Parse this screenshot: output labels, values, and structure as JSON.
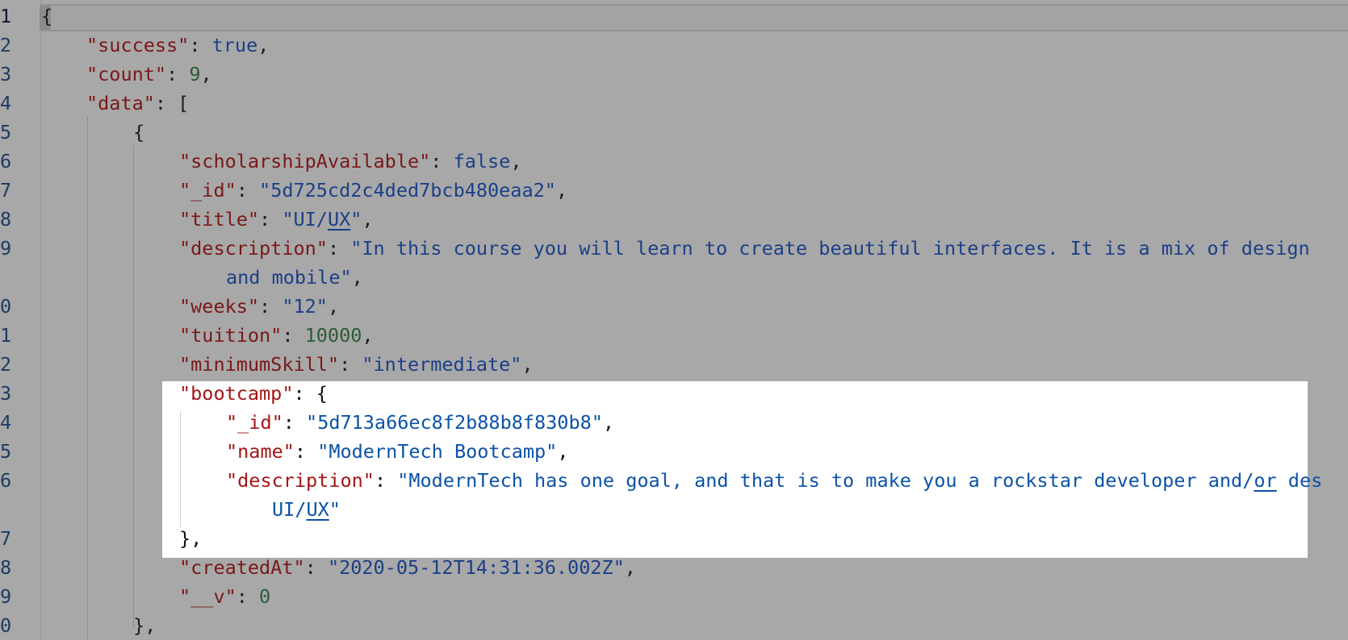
{
  "gutter": [
    "1",
    "2",
    "3",
    "4",
    "5",
    "6",
    "7",
    "8",
    "9",
    "0",
    "1",
    "2",
    "3",
    "4",
    "5",
    "6",
    "7",
    "8",
    "9",
    "0"
  ],
  "lines": [
    {
      "num_index": 0,
      "tokens": [
        {
          "t": "p",
          "v": "{"
        }
      ]
    },
    {
      "num_index": 1,
      "tokens": [
        {
          "t": "key",
          "v": "\"success\""
        },
        {
          "t": "p",
          "v": ": "
        },
        {
          "t": "bool",
          "v": "true"
        },
        {
          "t": "p",
          "v": ","
        }
      ]
    },
    {
      "num_index": 2,
      "tokens": [
        {
          "t": "key",
          "v": "\"count\""
        },
        {
          "t": "p",
          "v": ": "
        },
        {
          "t": "num",
          "v": "9"
        },
        {
          "t": "p",
          "v": ","
        }
      ]
    },
    {
      "num_index": 3,
      "tokens": [
        {
          "t": "key",
          "v": "\"data\""
        },
        {
          "t": "p",
          "v": ": ["
        }
      ]
    },
    {
      "num_index": 4,
      "tokens": [
        {
          "t": "p",
          "v": "{"
        }
      ]
    },
    {
      "num_index": 5,
      "tokens": [
        {
          "t": "key",
          "v": "\"scholarshipAvailable\""
        },
        {
          "t": "p",
          "v": ": "
        },
        {
          "t": "bool",
          "v": "false"
        },
        {
          "t": "p",
          "v": ","
        }
      ]
    },
    {
      "num_index": 6,
      "tokens": [
        {
          "t": "key",
          "v": "\"_id\""
        },
        {
          "t": "p",
          "v": ": "
        },
        {
          "t": "str",
          "v": "\"5d725cd2c4ded7bcb480eaa2\""
        },
        {
          "t": "p",
          "v": ","
        }
      ]
    },
    {
      "num_index": 7,
      "tokens": [
        {
          "t": "key",
          "v": "\"title\""
        },
        {
          "t": "p",
          "v": ": "
        },
        {
          "t": "str",
          "v": "\"UI/"
        },
        {
          "t": "str",
          "v": "UX",
          "link": true
        },
        {
          "t": "str",
          "v": "\""
        },
        {
          "t": "p",
          "v": ","
        }
      ]
    },
    {
      "num_index": 8,
      "tokens": [
        {
          "t": "key",
          "v": "\"description\""
        },
        {
          "t": "p",
          "v": ": "
        },
        {
          "t": "str",
          "v": "\"In this course you will learn to create beautiful interfaces. It is a mix of design"
        }
      ]
    },
    {
      "num_index": null,
      "tokens": [
        {
          "t": "str",
          "v": "and mobile\""
        },
        {
          "t": "p",
          "v": ","
        }
      ]
    },
    {
      "num_index": 9,
      "tokens": [
        {
          "t": "key",
          "v": "\"weeks\""
        },
        {
          "t": "p",
          "v": ": "
        },
        {
          "t": "str",
          "v": "\"12\""
        },
        {
          "t": "p",
          "v": ","
        }
      ]
    },
    {
      "num_index": 10,
      "tokens": [
        {
          "t": "key",
          "v": "\"tuition\""
        },
        {
          "t": "p",
          "v": ": "
        },
        {
          "t": "num",
          "v": "10000"
        },
        {
          "t": "p",
          "v": ","
        }
      ]
    },
    {
      "num_index": 11,
      "tokens": [
        {
          "t": "key",
          "v": "\"minimumSkill\""
        },
        {
          "t": "p",
          "v": ": "
        },
        {
          "t": "str",
          "v": "\"intermediate\""
        },
        {
          "t": "p",
          "v": ","
        }
      ]
    },
    {
      "num_index": 12,
      "tokens": [
        {
          "t": "key",
          "v": "\"bootcamp\""
        },
        {
          "t": "p",
          "v": ": {"
        }
      ]
    },
    {
      "num_index": 13,
      "tokens": [
        {
          "t": "key",
          "v": "\"_id\""
        },
        {
          "t": "p",
          "v": ": "
        },
        {
          "t": "str",
          "v": "\"5d713a66ec8f2b88b8f830b8\""
        },
        {
          "t": "p",
          "v": ","
        }
      ]
    },
    {
      "num_index": 14,
      "tokens": [
        {
          "t": "key",
          "v": "\"name\""
        },
        {
          "t": "p",
          "v": ": "
        },
        {
          "t": "str",
          "v": "\"ModernTech Bootcamp\""
        },
        {
          "t": "p",
          "v": ","
        }
      ]
    },
    {
      "num_index": 15,
      "tokens": [
        {
          "t": "key",
          "v": "\"description\""
        },
        {
          "t": "p",
          "v": ": "
        },
        {
          "t": "str",
          "v": "\"ModernTech has one goal, and that is to make you a rockstar developer and/"
        },
        {
          "t": "str",
          "v": "or",
          "link": true
        },
        {
          "t": "str",
          "v": " des"
        }
      ]
    },
    {
      "num_index": null,
      "tokens": [
        {
          "t": "str",
          "v": "UI/"
        },
        {
          "t": "str",
          "v": "UX",
          "link": true
        },
        {
          "t": "str",
          "v": "\""
        }
      ]
    },
    {
      "num_index": 16,
      "tokens": [
        {
          "t": "p",
          "v": "},"
        }
      ]
    },
    {
      "num_index": 17,
      "tokens": [
        {
          "t": "key",
          "v": "\"createdAt\""
        },
        {
          "t": "p",
          "v": ": "
        },
        {
          "t": "str",
          "v": "\"2020-05-12T14:31:36.002Z\""
        },
        {
          "t": "p",
          "v": ","
        }
      ]
    },
    {
      "num_index": 18,
      "tokens": [
        {
          "t": "key",
          "v": "\"__v\""
        },
        {
          "t": "p",
          "v": ": "
        },
        {
          "t": "num",
          "v": "0"
        }
      ]
    },
    {
      "num_index": 19,
      "tokens": [
        {
          "t": "p",
          "v": "},"
        }
      ]
    }
  ]
}
